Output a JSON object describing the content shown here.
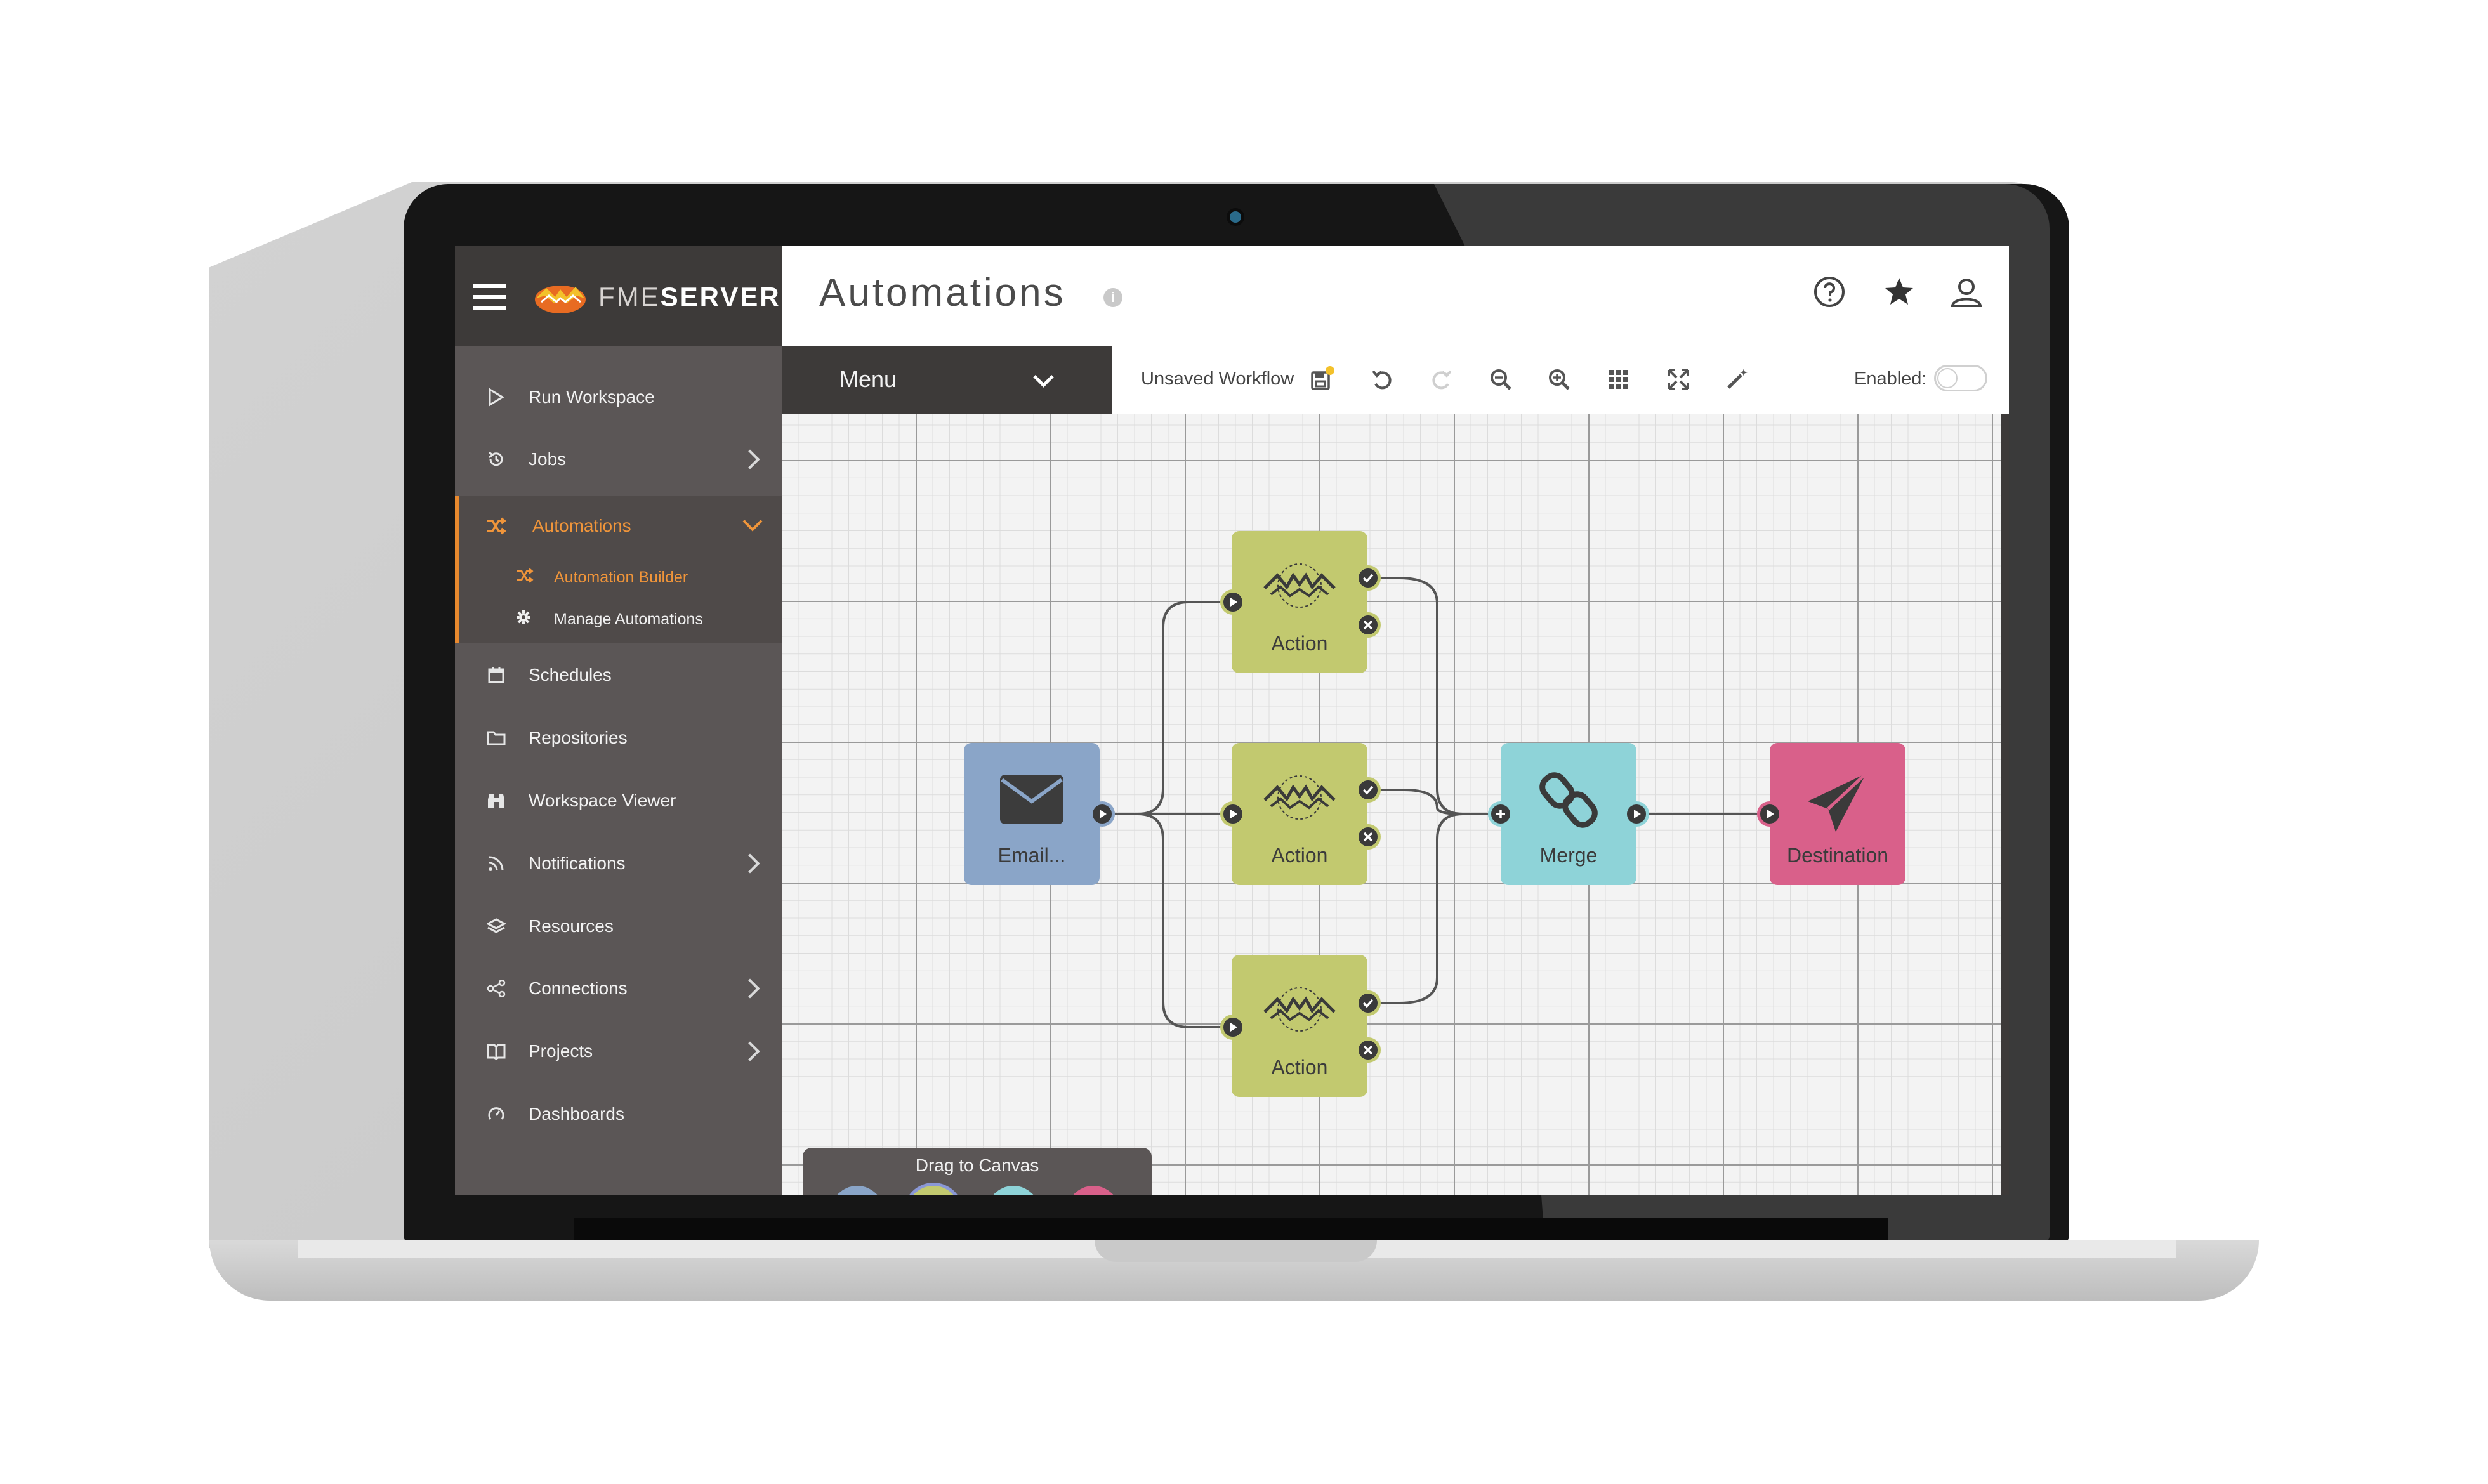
{
  "brand": {
    "prefix": "FME",
    "suffix": "SERVER"
  },
  "header": {
    "title": "Automations"
  },
  "sidebar": {
    "items": [
      {
        "label": "Run Workspace",
        "icon": "play-outline-icon"
      },
      {
        "label": "Jobs",
        "icon": "history-icon"
      },
      {
        "label": "Automations",
        "icon": "shuffle-icon"
      },
      {
        "label": "Schedules",
        "icon": "calendar-icon"
      },
      {
        "label": "Repositories",
        "icon": "folder-icon"
      },
      {
        "label": "Workspace Viewer",
        "icon": "binoculars-icon"
      },
      {
        "label": "Notifications",
        "icon": "rss-icon"
      },
      {
        "label": "Resources",
        "icon": "layers-icon"
      },
      {
        "label": "Connections",
        "icon": "share-icon"
      },
      {
        "label": "Projects",
        "icon": "book-icon"
      },
      {
        "label": "Dashboards",
        "icon": "gauge-icon"
      }
    ],
    "sub_items": [
      {
        "label": "Automation Builder",
        "icon": "shuffle-icon"
      },
      {
        "label": "Manage Automations",
        "icon": "gear-icon"
      }
    ]
  },
  "toolbar": {
    "menu_label": "Menu",
    "workflow_name": "Unsaved Workflow",
    "enabled_label": "Enabled:",
    "enabled": false
  },
  "canvas": {
    "nodes": [
      {
        "label": "Email...",
        "color": "#8aa5c8"
      },
      {
        "label": "Action",
        "color": "#c2c96f"
      },
      {
        "label": "Action",
        "color": "#c2c96f"
      },
      {
        "label": "Action",
        "color": "#c2c96f"
      },
      {
        "label": "Merge",
        "color": "#8ed3d8"
      },
      {
        "label": "Destination",
        "color": "#d9608a"
      }
    ]
  },
  "drag_panel": {
    "label": "Drag to Canvas"
  },
  "colors": {
    "accent": "#f0953a",
    "sidebar": "#5b5656",
    "sidebar_dark": "#3d3a39"
  }
}
